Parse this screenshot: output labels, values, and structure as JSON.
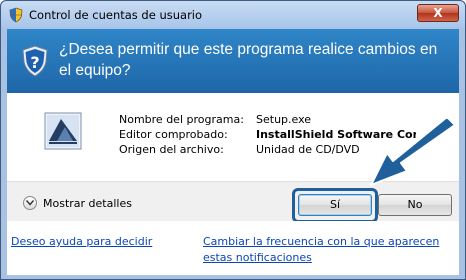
{
  "window": {
    "title": "Control de cuentas de usuario",
    "close_label": "X"
  },
  "header": {
    "question": "¿Desea permitir que este programa realice cambios en el equipo?"
  },
  "program_info": {
    "labels": [
      "Nombre del programa:",
      "Editor comprobado:",
      "Origen del archivo:"
    ],
    "values": [
      "Setup.exe",
      "InstallShield Software Corporation",
      "Unidad de CD/DVD"
    ]
  },
  "footer": {
    "details_label": "Mostrar detalles",
    "yes_label": "Sí",
    "no_label": "No"
  },
  "links": {
    "help": "Deseo ayuda para decidir",
    "frequency": "Cambiar la frecuencia con la que aparecen estas notificaciones"
  },
  "colors": {
    "header_blue": "#2f86c8",
    "frame_blue": "#a9c2e3",
    "link_blue": "#0b46b8",
    "arrow_blue": "#1f5f9c"
  }
}
